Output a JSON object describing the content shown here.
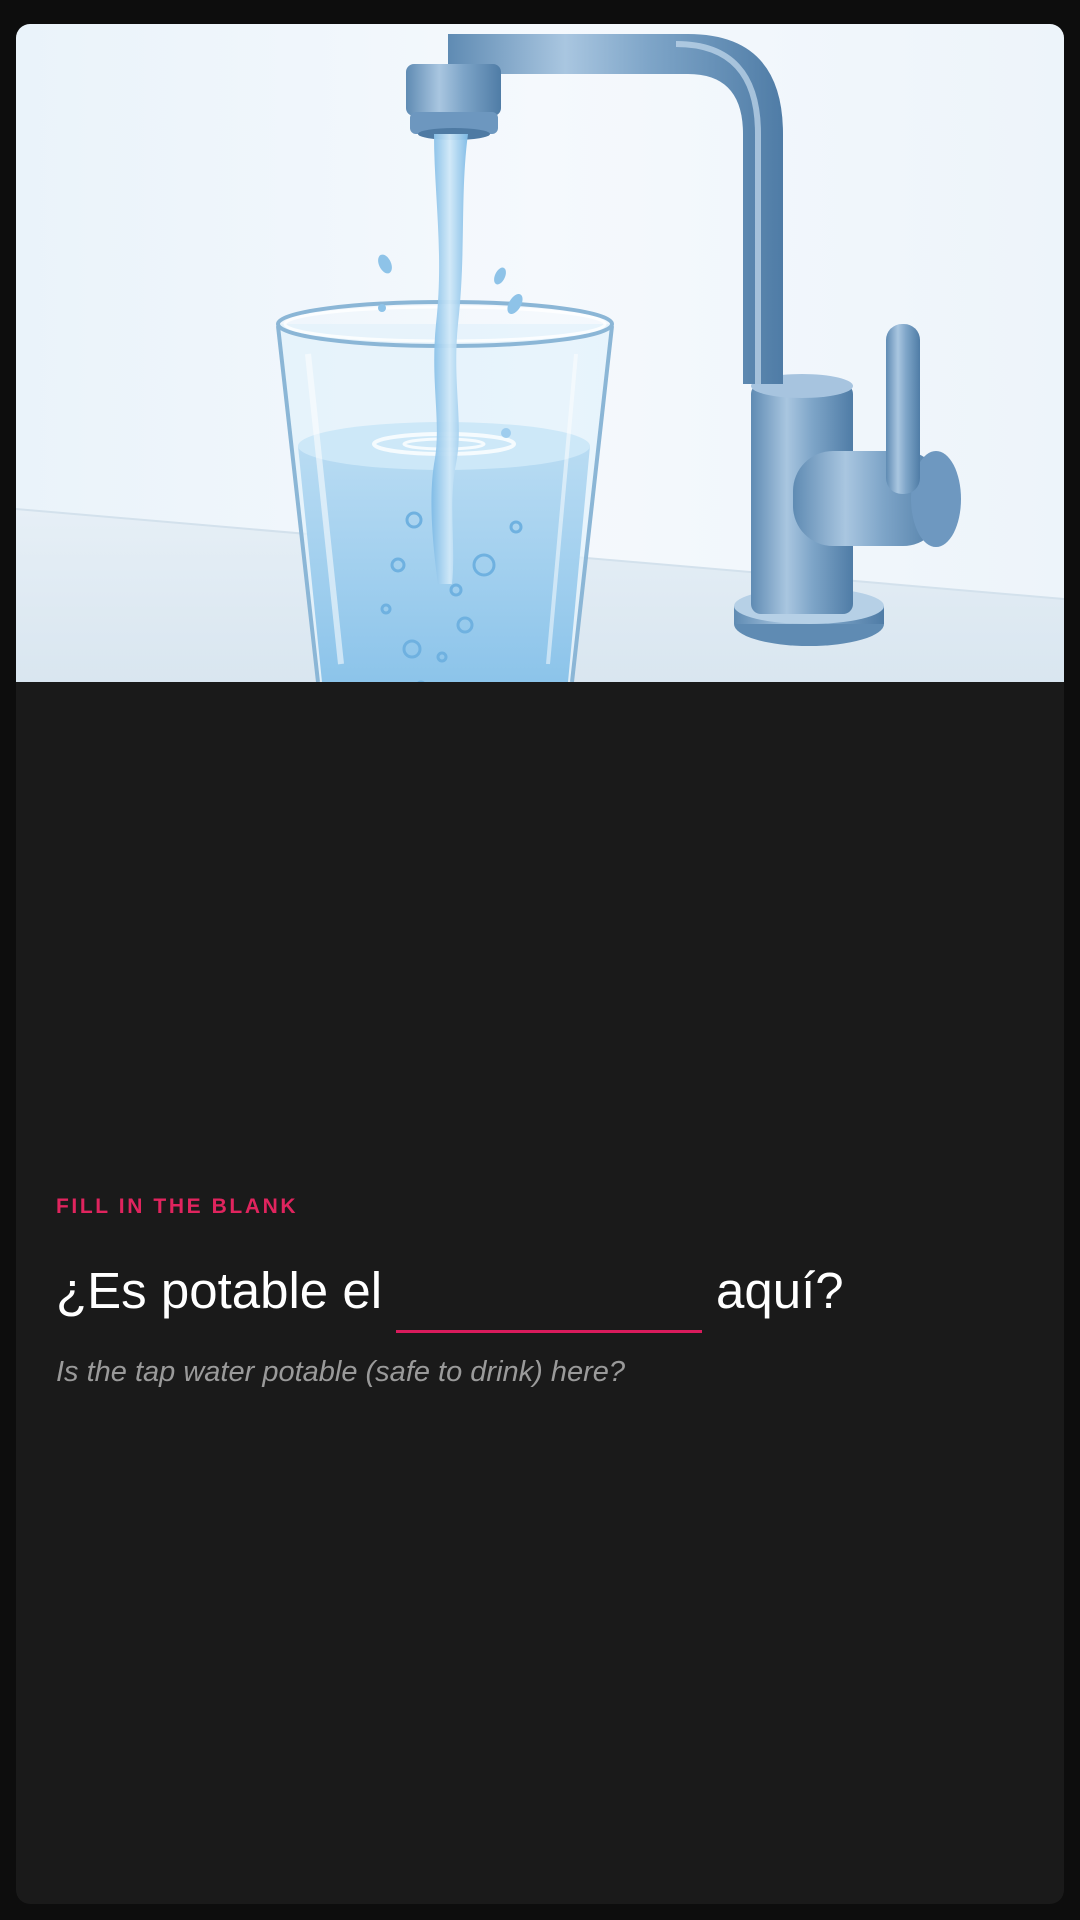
{
  "exercise": {
    "eyebrow": "FILL IN THE BLANK",
    "sentence_before": "¿Es potable el",
    "answer_value": "",
    "sentence_after": "aquí?",
    "translation": "Is the tap water potable (safe to drink) here?"
  },
  "illustration": {
    "subject": "water-glass-and-faucet-illustration"
  },
  "colors": {
    "accent": "#e0245e",
    "background": "#1a1a1a",
    "outer_background": "#0d0d0d",
    "text_primary": "#ffffff",
    "text_secondary": "#9a9a9a"
  }
}
